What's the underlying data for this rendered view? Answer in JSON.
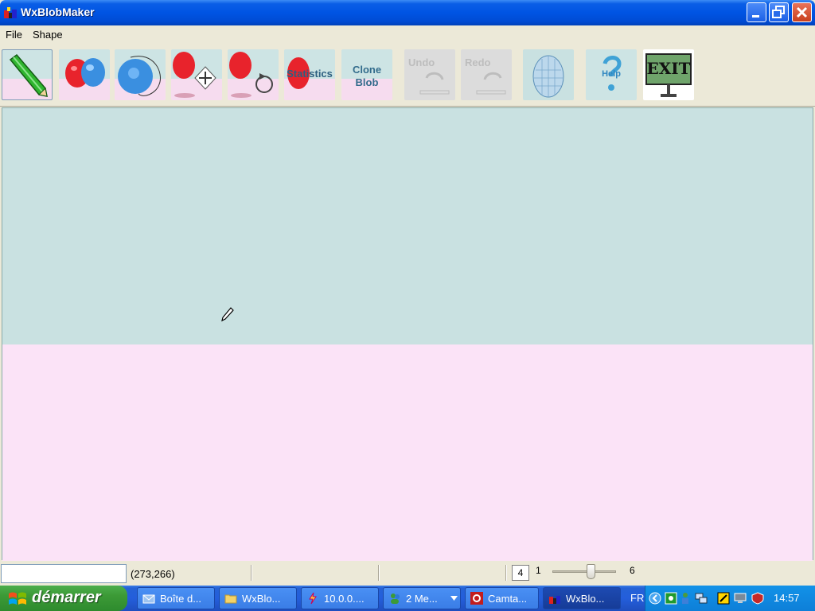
{
  "window": {
    "title": "WxBlobMaker"
  },
  "menu": {
    "file": "File",
    "shape": "Shape"
  },
  "toolbar": {
    "statistics_label": "Statistics",
    "clone_label_1": "Clone",
    "clone_label_2": "Blob",
    "undo_label": "Undo",
    "redo_label": "Redo",
    "help_label": "Help",
    "exit_label": "EXIT"
  },
  "status": {
    "field_value": "",
    "coords": "(273,266)",
    "zoom_value": "4",
    "zoom_min": "1",
    "zoom_max": "6"
  },
  "taskbar": {
    "start_label": "démarrer",
    "tasks": [
      {
        "label": "Boîte d..."
      },
      {
        "label": "WxBlo..."
      },
      {
        "label": "10.0.0...."
      },
      {
        "label": "2 Me..."
      },
      {
        "label": "Camta..."
      },
      {
        "label": "WxBlo..."
      }
    ],
    "lang": "FR",
    "clock": "14:57"
  },
  "colors": {
    "canvas_top": "#c9e1e1",
    "canvas_bottom": "#fbe3f7",
    "titlebar": "#0054e3",
    "blob_red": "#e8232c",
    "blob_blue": "#3a8fe0"
  }
}
